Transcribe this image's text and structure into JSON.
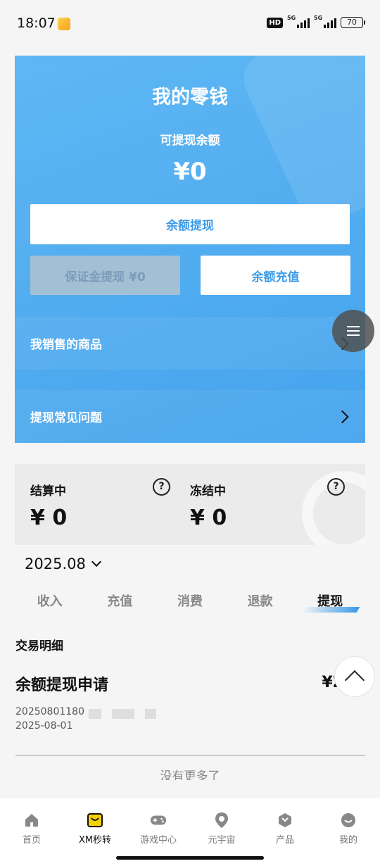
{
  "status_bar": {
    "time": "18:07",
    "hd": "HD",
    "network_1": "5G",
    "network_2": "5G",
    "battery": "70"
  },
  "wallet": {
    "title": "我的零钱",
    "balance_label": "可提现余额",
    "balance_value": "¥0",
    "withdraw_button": "余额提现",
    "deposit_withdraw_button": "保证金提现 ¥0",
    "recharge_button": "余额充值",
    "rows": [
      {
        "label": "我销售的商品"
      },
      {
        "label": "提现常见问题"
      }
    ]
  },
  "settlement": {
    "settling": {
      "label": "结算中",
      "value": "¥ 0"
    },
    "frozen": {
      "label": "冻结中",
      "value": "¥ 0"
    }
  },
  "month_filter": {
    "value": "2025.08"
  },
  "tabs": [
    {
      "label": "收入",
      "active": false
    },
    {
      "label": "充值",
      "active": false
    },
    {
      "label": "消费",
      "active": false
    },
    {
      "label": "退款",
      "active": false
    },
    {
      "label": "提现",
      "active": true
    }
  ],
  "transactions": {
    "section_title": "交易明细",
    "items": [
      {
        "title": "余额提现申请",
        "amount": "¥2",
        "id": "20250801180",
        "date": "2025-08-01"
      }
    ],
    "no_more": "没有更多了"
  },
  "bottom_nav": [
    {
      "label": "首页",
      "icon": "home-icon",
      "active": false
    },
    {
      "label": "XM秒转",
      "icon": "bag-icon",
      "active": true
    },
    {
      "label": "游戏中心",
      "icon": "gamepad-icon",
      "active": false
    },
    {
      "label": "元宇宙",
      "icon": "location-pin-icon",
      "active": false
    },
    {
      "label": "产品",
      "icon": "product-box-icon",
      "active": false
    },
    {
      "label": "我的",
      "icon": "profile-face-icon",
      "active": false
    }
  ],
  "colors": {
    "accent": "#3d9be8",
    "card_gradient_start": "#5fb7f3",
    "card_gradient_end": "#45a3ed",
    "active_bag": "#f5d000"
  }
}
